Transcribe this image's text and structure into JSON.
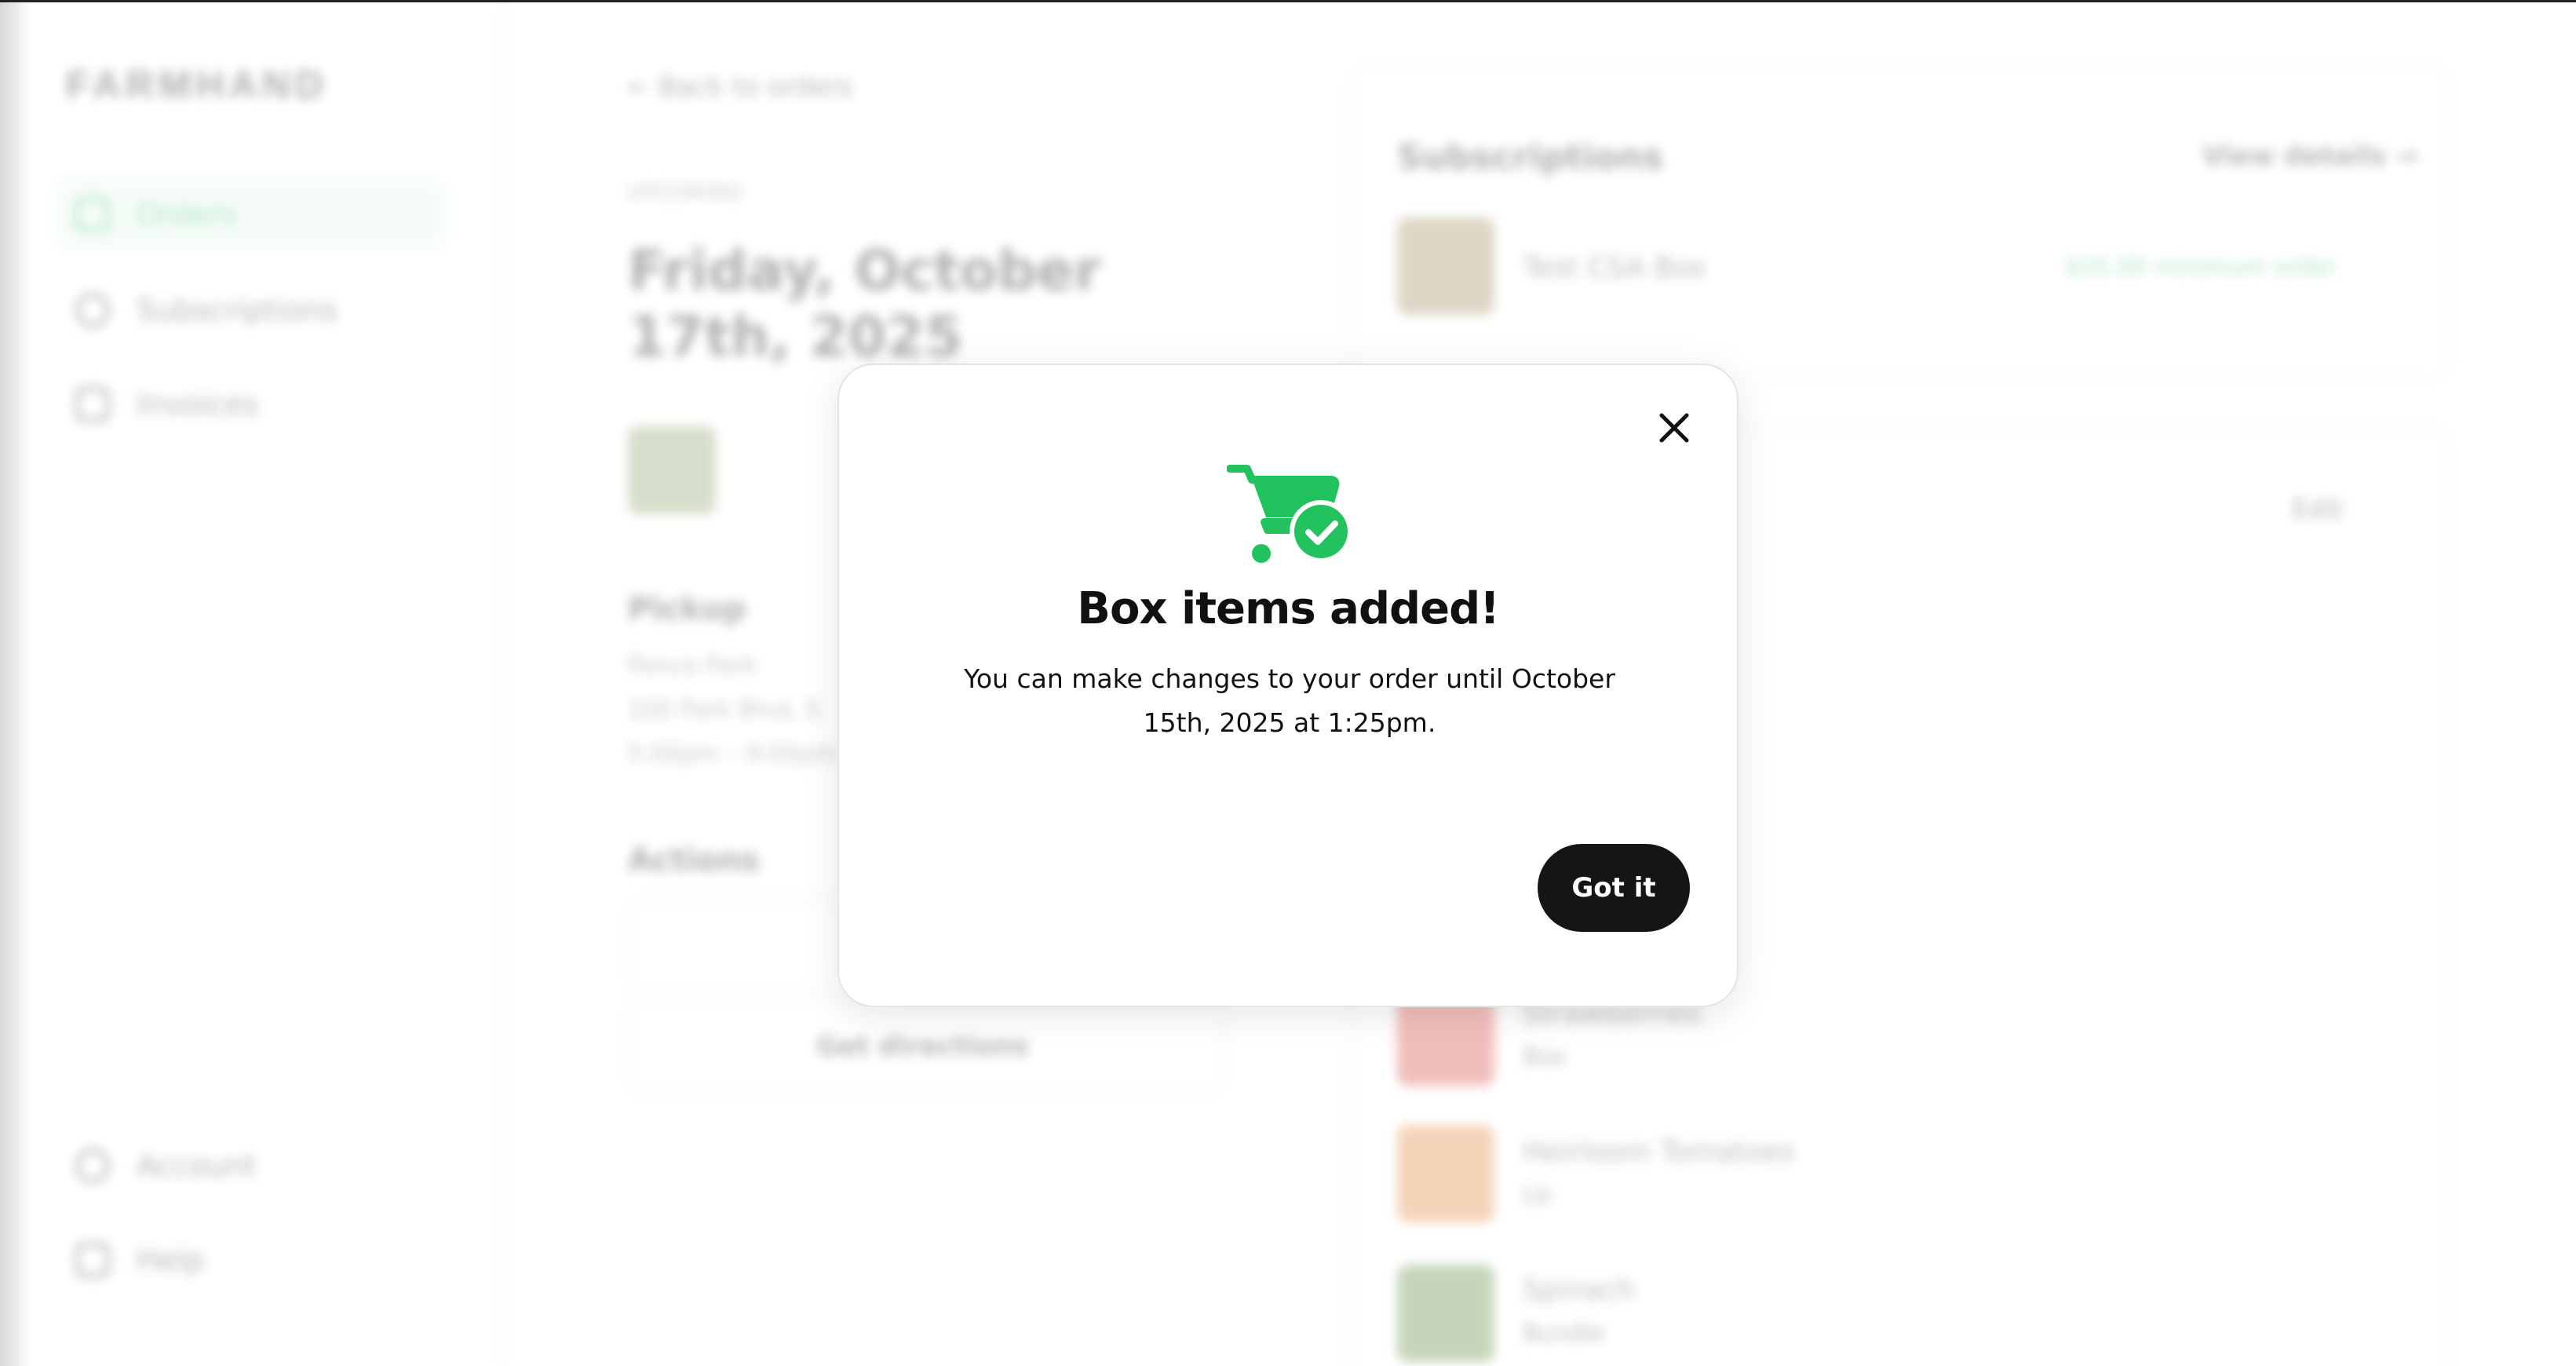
{
  "background": {
    "brand": "FARMHAND",
    "nav": [
      {
        "label": "Orders",
        "icon": "cart-icon",
        "active": true
      },
      {
        "label": "Subscriptions",
        "icon": "repeat-icon",
        "active": false
      },
      {
        "label": "Invoices",
        "icon": "receipt-icon",
        "active": false
      }
    ],
    "nav_bottom": [
      {
        "label": "Account",
        "icon": "user-icon"
      },
      {
        "label": "Help",
        "icon": "help-icon"
      }
    ],
    "back_link": "← Back to orders",
    "eyebrow": "UPCOMING",
    "order_date": "Friday, October 17th, 2025",
    "pickup": {
      "heading": "Pickup",
      "location": "Pence Park",
      "address": "100 Park Blvd, S",
      "time": "5:00pm – 9:00pm"
    },
    "actions": {
      "heading": "Actions",
      "get_directions": "Get directions"
    },
    "subscriptions": {
      "title": "Subscriptions",
      "view_details": "View details →",
      "item_name": "Test CSA Box",
      "item_status": "$25.00 minimum order"
    },
    "edit_label": "Edit",
    "items": [
      {
        "name": "Strawberries",
        "unit": "Box",
        "color": "#d9443f"
      },
      {
        "name": "Heirloom Tomatoes",
        "unit": "Lb",
        "color": "#e2863a"
      },
      {
        "name": "Spinach",
        "unit": "Bundle",
        "color": "#5c8a3c"
      }
    ]
  },
  "modal": {
    "title": "Box items added!",
    "message": "You can make changes to your order until October 15th, 2025 at 1:25pm.",
    "confirm_label": "Got it",
    "icon": "cart-check-icon",
    "accent_color": "#22c35e"
  }
}
